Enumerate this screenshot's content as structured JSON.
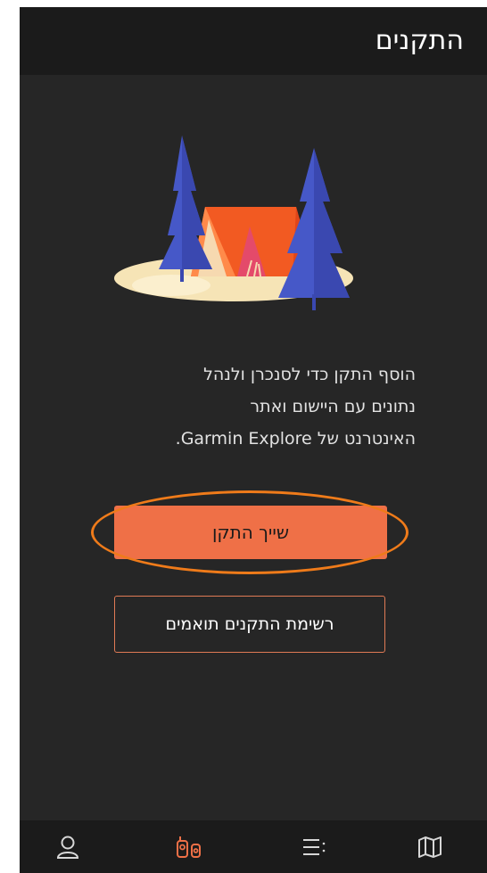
{
  "header": {
    "title": "התקנים"
  },
  "empty_state": {
    "description_lines": [
      "הוסף התקן כדי לסנכרן ולנהל",
      "נתונים עם היישום ואתר",
      "האינטרנט של Garmin Explore."
    ]
  },
  "buttons": {
    "pair_device": "שייך התקן",
    "compatible_devices": "רשימת התקנים תואמים"
  },
  "bottom_nav": {
    "items": [
      {
        "icon": "person-icon",
        "active": false
      },
      {
        "icon": "devices-icon",
        "active": true
      },
      {
        "icon": "menu-list-icon",
        "active": false
      },
      {
        "icon": "map-icon",
        "active": false
      }
    ]
  },
  "colors": {
    "accent": "#ef7047",
    "annotation_circle": "#ef7b1a",
    "background": "#262626",
    "bar": "#1b1b1b"
  }
}
